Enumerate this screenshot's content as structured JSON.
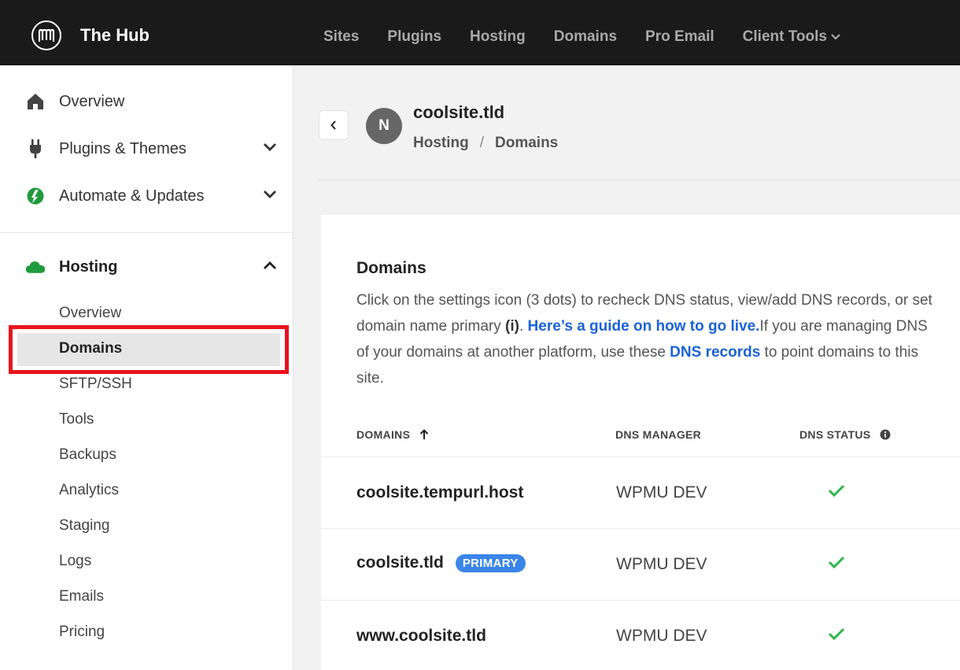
{
  "app": {
    "brand": "The Hub"
  },
  "topnav": [
    {
      "label": "Sites"
    },
    {
      "label": "Plugins"
    },
    {
      "label": "Hosting"
    },
    {
      "label": "Domains"
    },
    {
      "label": "Pro Email"
    },
    {
      "label": "Client Tools"
    }
  ],
  "sidebar": {
    "items": [
      {
        "label": "Overview",
        "icon": "home-icon"
      },
      {
        "label": "Plugins & Themes",
        "icon": "plug-icon"
      },
      {
        "label": "Automate & Updates",
        "icon": "automate-icon"
      },
      {
        "label": "Hosting",
        "icon": "cloud-icon"
      }
    ],
    "hosting_sub": [
      {
        "label": "Overview"
      },
      {
        "label": "Domains"
      },
      {
        "label": "SFTP/SSH"
      },
      {
        "label": "Tools"
      },
      {
        "label": "Backups"
      },
      {
        "label": "Analytics"
      },
      {
        "label": "Staging"
      },
      {
        "label": "Logs"
      },
      {
        "label": "Emails"
      },
      {
        "label": "Pricing"
      }
    ]
  },
  "header": {
    "avatar_letter": "N",
    "site_title": "coolsite.tld",
    "breadcrumb": [
      "Hosting",
      "Domains"
    ],
    "breadcrumb_sep": "/"
  },
  "card": {
    "title": "Domains",
    "desc_1": "Click on the settings icon (3 dots) to recheck DNS status, view/add DNS records, or set domain name primary ",
    "desc_info": "(i)",
    "desc_2": ". ",
    "desc_link1": "Here’s a guide on how to go live.",
    "desc_3": "If you are managing DNS of your domains at another platform, use these ",
    "desc_link2": "DNS records",
    "desc_4": " to point domains to this site.",
    "columns": {
      "domains": "DOMAINS",
      "dns_manager": "DNS MANAGER",
      "dns_status": "DNS STATUS"
    },
    "rows": [
      {
        "domain": "coolsite.tempurl.host",
        "badge": "",
        "manager": "WPMU DEV",
        "status": "ok"
      },
      {
        "domain": "coolsite.tld",
        "badge": "PRIMARY",
        "manager": "WPMU DEV",
        "status": "ok"
      },
      {
        "domain": "www.coolsite.tld",
        "badge": "",
        "manager": "WPMU DEV",
        "status": "ok"
      }
    ]
  },
  "colors": {
    "accent_link": "#1a63d8",
    "primary_badge": "#3a86e8",
    "check_green": "#2fb54a",
    "highlight_red": "#e8141d",
    "topbar": "#1a1a1a"
  }
}
